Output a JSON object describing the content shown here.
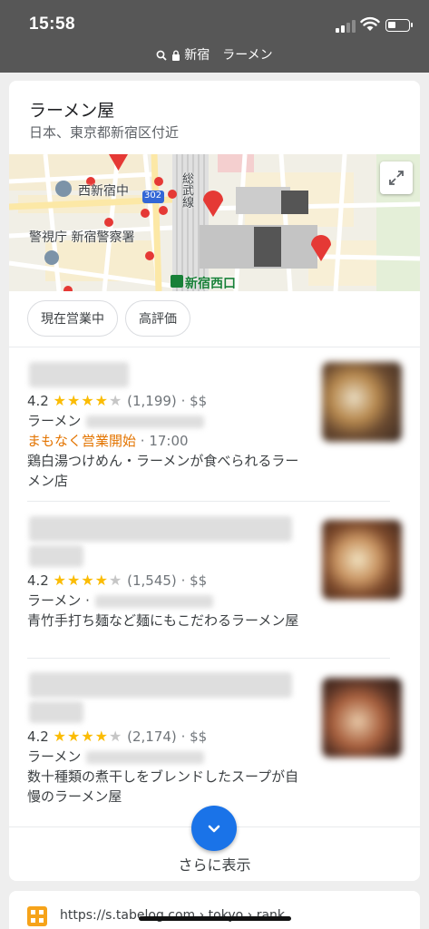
{
  "status_bar": {
    "time": "15:58"
  },
  "address_bar": {
    "query": "新宿　ラーメン"
  },
  "local_card": {
    "title": "ラーメン屋",
    "subtitle": "日本、東京都新宿区付近",
    "map_labels": {
      "nishi_shinjuku_chu": "西新宿中",
      "keishicho": "警視庁 新宿警察署",
      "route": "302",
      "line": "総武線",
      "station": "新宿西口"
    },
    "filters": [
      "現在営業中",
      "高評価"
    ],
    "results": [
      {
        "rating": "4.2",
        "stars": 4,
        "reviews": "(1,199)",
        "price": "· $$",
        "category": "ラーメン",
        "status": "まもなく営業開始",
        "status_time": "· 17:00",
        "description": "鶏白湯つけめん・ラーメンが食べられるラーメン店"
      },
      {
        "rating": "4.2",
        "stars": 4,
        "reviews": "(1,545)",
        "price": "· $$",
        "category": "ラーメン ·",
        "description": "青竹手打ち麺など麺にもこだわるラーメン屋"
      },
      {
        "rating": "4.2",
        "stars": 4,
        "reviews": "(2,174)",
        "price": "· $$",
        "category": "ラーメン",
        "description": "数十種類の煮干しをブレンドしたスープが自慢のラーメン屋"
      }
    ],
    "more_label": "さらに表示"
  },
  "next_result": {
    "url": "https://s.tabelog.com › tokyo › rank"
  },
  "colors": {
    "accent": "#1a73e8",
    "star": "#fbbc04",
    "opening": "#e37400",
    "status_bar": "#575757"
  }
}
